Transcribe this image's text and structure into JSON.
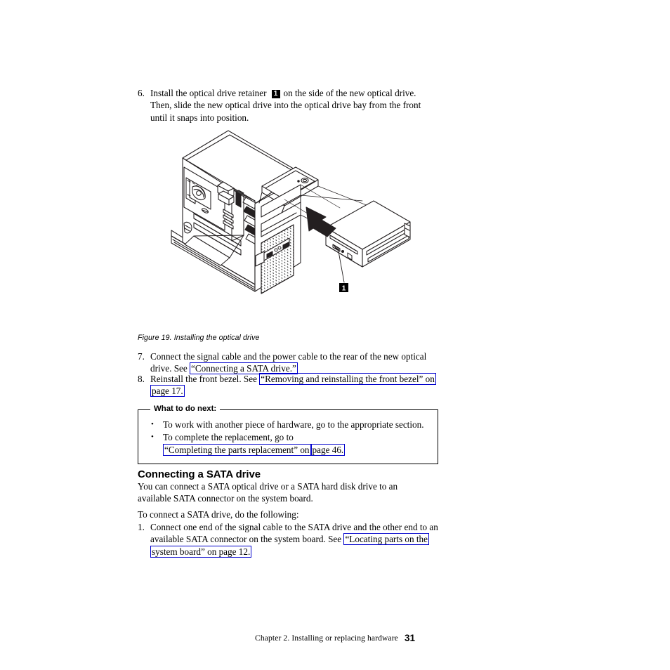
{
  "document": {
    "page_number": "31",
    "footer_chapter": "Chapter 2. Installing or replacing hardware"
  },
  "step6": {
    "number": "6.",
    "text_before_callout": "Install the optical drive retainer",
    "callout": "1",
    "text_after_callout": "on the side of the new optical drive. Then, slide the new optical drive into the optical drive bay from the front until it snaps into position."
  },
  "figure": {
    "caption": "Figure 19. Installing the optical drive",
    "callout_1": "1",
    "alt_name": "installing-the-optical-drive-illustration"
  },
  "step7": {
    "number": "7.",
    "text_before_link": "Connect the signal cable and the power cable to the rear of the new optical drive. See",
    "link": "“Connecting a SATA drive.”"
  },
  "step8": {
    "number": "8.",
    "text_before_link": "Reinstall the front bezel. See",
    "link_part1": "“Removing and reinstalling the front bezel” on",
    "link_part2": "page 17."
  },
  "what_to_do_next": {
    "legend": "What to do next:",
    "bullet_char": "•",
    "items": [
      {
        "text": "To work with another piece of hardware, go to the appropriate section.",
        "link_part1": "",
        "link_part2": ""
      },
      {
        "text": "To complete the replacement, go to",
        "link_part1": "“Completing the parts replacement” on",
        "link_part2": "page 46."
      }
    ]
  },
  "sata_section": {
    "heading": "Connecting a SATA drive",
    "intro": "You can connect a SATA optical drive or a SATA hard disk drive to an available SATA connector on the system board.",
    "lead_in": "To connect a SATA drive, do the following:",
    "step1": {
      "number": "1.",
      "text_before_link": "Connect one end of the signal cable to the SATA drive and the other end to an available SATA connector on the system board. See",
      "link_part1": "“Locating parts on the",
      "link_part2": "system board” on page 12."
    }
  },
  "colors": {
    "link_border": "#0000CC",
    "text": "#000000",
    "page_background": "#ffffff",
    "callout_badge_background": "#000000",
    "callout_badge_text": "#ffffff",
    "illustration_line": "#231f20"
  }
}
